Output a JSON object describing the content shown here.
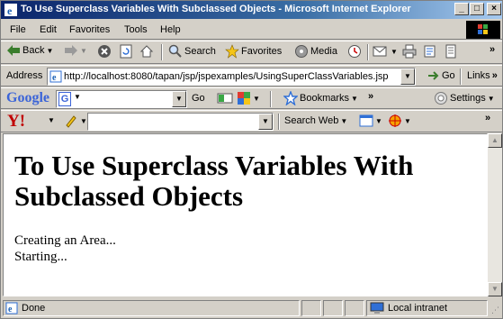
{
  "window": {
    "title": "To Use Superclass Variables With Subclassed Objects - Microsoft Internet Explorer",
    "min_label": "_",
    "max_label": "□",
    "close_label": "×"
  },
  "menu": {
    "items": [
      "File",
      "Edit",
      "Favorites",
      "Tools",
      "Help"
    ]
  },
  "standard_toolbar": {
    "back_label": "Back",
    "search_label": "Search",
    "favorites_label": "Favorites",
    "media_label": "Media"
  },
  "address_bar": {
    "label": "Address",
    "url": "http://localhost:8080/tapan/jsp/jspexamples/UsingSuperClassVariables.jsp",
    "go_label": "Go",
    "links_label": "Links"
  },
  "google_toolbar": {
    "brand": "Google",
    "go_label": "Go",
    "bookmarks_label": "Bookmarks",
    "settings_label": "Settings"
  },
  "yahoo_toolbar": {
    "brand": "Y!",
    "search_web_label": "Search Web"
  },
  "page": {
    "heading": "To Use Superclass Variables With Subclassed Objects",
    "lines": [
      "Creating an Area...",
      "Starting..."
    ]
  },
  "status": {
    "text": "Done",
    "zone": "Local intranet"
  },
  "colors": {
    "titlebar_start": "#0a246a",
    "chrome": "#d4d0c8"
  }
}
